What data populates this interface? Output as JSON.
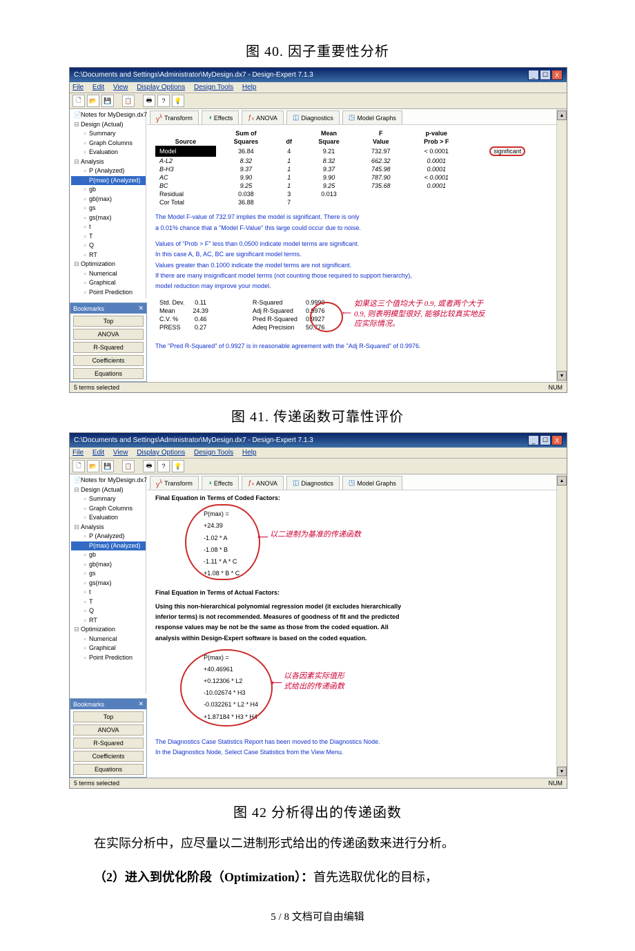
{
  "captions": {
    "c40": "图 40.  因子重要性分析",
    "c41": "图 41.  传递函数可靠性评价",
    "c42": "图 42  分析得出的传递函数"
  },
  "window": {
    "title": "C:\\Documents and Settings\\Administrator\\MyDesign.dx7 - Design-Expert 7.1.3",
    "min": "_",
    "max": "☐",
    "close": "X"
  },
  "menu": {
    "file": "File",
    "edit": "Edit",
    "view": "View",
    "display": "Display Options",
    "design": "Design Tools",
    "help": "Help"
  },
  "tree": {
    "notes": "Notes for MyDesign.dx7",
    "design": "Design (Actual)",
    "summary": "Summary",
    "graphcols": "Graph Columns",
    "evaluation": "Evaluation",
    "analysis": "Analysis",
    "p_analyzed": "P (Analyzed)",
    "pmax_analyzed": "P(max) (Analyzed)",
    "gb": "gb",
    "gbmax": "gb(max)",
    "gs": "gs",
    "gsmax": "gs(max)",
    "t_low": "t",
    "t_cap": "T",
    "q_cap": "Q",
    "rt": "RT",
    "optimization": "Optimization",
    "numerical": "Numerical",
    "graphical": "Graphical",
    "pointpred": "Point Prediction"
  },
  "bookmarks": {
    "title": "Bookmarks",
    "top": "Top",
    "anova": "ANOVA",
    "rsq": "R-Squared",
    "coef": "Coefficients",
    "eq": "Equations"
  },
  "tabs": {
    "transform": "Transform",
    "effects": "Effects",
    "anova": "ANOVA",
    "diagnostics": "Diagnostics",
    "modelgraphs": "Model Graphs"
  },
  "anova_table": {
    "headers": {
      "source": "Source",
      "sumof": "Sum of",
      "squares": "Squares",
      "df": "df",
      "mean": "Mean",
      "square": "Square",
      "f": "F",
      "value": "Value",
      "pvalue": "p-value",
      "probf": "Prob > F"
    },
    "rows": [
      {
        "src": "Model",
        "ss": "36.84",
        "df": "4",
        "ms": "9.21",
        "f": "732.97",
        "p": "< 0.0001",
        "sig": "significant"
      },
      {
        "src": "A-L2",
        "ss": "8.32",
        "df": "1",
        "ms": "8.32",
        "f": "662.32",
        "p": "0.0001",
        "sig": "",
        "it": true
      },
      {
        "src": "B-H3",
        "ss": "9.37",
        "df": "1",
        "ms": "9.37",
        "f": "745.98",
        "p": "0.0001",
        "sig": "",
        "it": true
      },
      {
        "src": "AC",
        "ss": "9.90",
        "df": "1",
        "ms": "9.90",
        "f": "787.90",
        "p": "< 0.0001",
        "sig": "",
        "it": true
      },
      {
        "src": "BC",
        "ss": "9.25",
        "df": "1",
        "ms": "9.25",
        "f": "735.68",
        "p": "0.0001",
        "sig": "",
        "it": true
      },
      {
        "src": "Residual",
        "ss": "0.038",
        "df": "3",
        "ms": "0.013",
        "f": "",
        "p": "",
        "sig": ""
      },
      {
        "src": "Cor Total",
        "ss": "36.88",
        "df": "7",
        "ms": "",
        "f": "",
        "p": "",
        "sig": ""
      }
    ]
  },
  "stats_block": {
    "rows": [
      {
        "a": "Std. Dev.",
        "b": "0.11",
        "c": "R-Squared",
        "d": "0.9990"
      },
      {
        "a": "Mean",
        "b": "24.39",
        "c": "Adj R-Squared",
        "d": "0.9976"
      },
      {
        "a": "C.V. %",
        "b": "0.46",
        "c": "Pred R-Squared",
        "d": "0.9927"
      },
      {
        "a": "PRESS",
        "b": "0.27",
        "c": "Adeq Precision",
        "d": "50.776"
      }
    ]
  },
  "bluetext": {
    "l1": "The Model F-value of 732.97 implies the model is significant.  There is only",
    "l2": "a 0.01% chance that a \"Model F-Value\" this large could occur due to noise.",
    "l3": "Values of \"Prob > F\" less than 0.0500 indicate model terms are significant.",
    "l4": "In this case A, B, AC, BC are significant model terms.",
    "l5": "Values greater than 0.1000 indicate the model terms are not significant.",
    "l6": "If there are many insignificant model terms (not counting those required to support hierarchy),",
    "l7": "model reduction may improve your model.",
    "l8": "The \"Pred R-Squared\" of 0.9927 is in reasonable agreement with the \"Adj R-Squared\" of 0.9976."
  },
  "redcn": {
    "r1_a": "如果这三个值均大于 0.9, 或者两个大于",
    "r1_b": "0.9, 则表明模型很好, 能够比较真实地反",
    "r1_c": "应实际情况。",
    "r2": "以二进制为基准的传递函数",
    "r3_a": "以各因素实际值形",
    "r3_b": "式给出的传递函数"
  },
  "eq_sections": {
    "coded_title": "Final Equation in Terms of Coded Factors:",
    "actual_title": "Final Equation in Terms of Actual Factors:",
    "pmax_eq": "P(max)  =",
    "coded_lines": [
      "+24.39",
      "-1.02  * A",
      "-1.08  * B",
      "-1.11  * A * C",
      "+1.08  * B * C"
    ],
    "actual_lines": [
      "+40.46961",
      "+0.12306  * L2",
      "-10.02674  * H3",
      "-0.032261  * L2 * H4",
      "+1.87184  * H3 * H4"
    ],
    "nonhier1": "Using this non-hierarchical polynomial regression model (it excludes hierarchically",
    "nonhier2": "inferior terms) is not recommended.  Measures of goodness of fit and the predicted",
    "nonhier3": "response values may be not be the same as those from the coded equation.  All",
    "nonhier4": "analysis within Design-Expert software is based on the coded equation.",
    "diag1": "The Diagnostics Case Statistics Report has been moved to the Diagnostics Node.",
    "diag2": "In the Diagnostics Node, Select Case Statistics from the View Menu."
  },
  "statusbar": {
    "left": "5 terms selected",
    "right": "NUM"
  },
  "body_paragraph": "在实际分析中，应尽量以二进制形式给出的传递函数来进行分析。",
  "body_paragraph2_bold": "（2）进入到优化阶段（Optimization）：",
  "body_paragraph2_rest": "首先选取优化的目标，",
  "footer": "5 / 8 文档可自由编辑"
}
